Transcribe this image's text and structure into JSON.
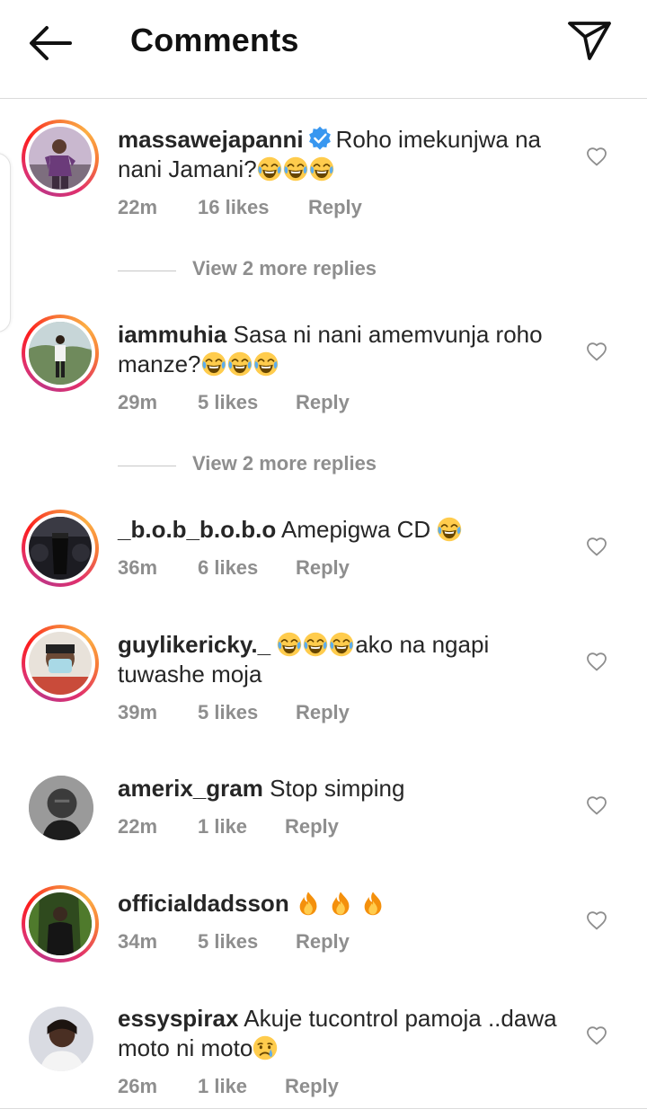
{
  "header": {
    "title": "Comments",
    "back_icon": "arrow-left-icon",
    "send_icon": "paper-plane-icon"
  },
  "view_replies_label": "View 2 more replies",
  "reply_label": "Reply",
  "comments": [
    {
      "username": "massawejapanni",
      "verified": true,
      "text": "Roho imekunjwa na nani Jamani?",
      "emojis": [
        "face-with-tears-of-joy",
        "face-with-tears-of-joy",
        "face-with-tears-of-joy"
      ],
      "time": "22m",
      "likes": "16 likes",
      "story_ring": true
    },
    {
      "username": "iammuhia",
      "text": "Sasa ni nani amemvunja roho manze?",
      "emojis": [
        "face-with-tears-of-joy",
        "face-with-tears-of-joy",
        "face-with-tears-of-joy"
      ],
      "time": "29m",
      "likes": "5 likes",
      "story_ring": true
    },
    {
      "username": "_b.o.b_b.o.b.o",
      "text": "Amepigwa CD",
      "emojis": [
        "face-with-tears-of-joy"
      ],
      "time": "36m",
      "likes": "6 likes",
      "story_ring": true
    },
    {
      "username": "guylikericky._",
      "text_after_emojis": "ako na ngapi tuwashe moja",
      "emojis": [
        "face-with-tears-of-joy",
        "face-with-tears-of-joy",
        "face-with-tears-of-joy"
      ],
      "time": "39m",
      "likes": "5 likes",
      "story_ring": true
    },
    {
      "username": "amerix_gram",
      "text": "Stop simping",
      "time": "22m",
      "likes": "1 like",
      "story_ring": false
    },
    {
      "username": "officialdadsson",
      "emojis": [
        "fire",
        "fire",
        "fire"
      ],
      "time": "34m",
      "likes": "5 likes",
      "story_ring": true
    },
    {
      "username": "essyspirax",
      "text": "Akuje tucontrol pamoja ..dawa moto ni moto",
      "emojis": [
        "crying-face"
      ],
      "time": "26m",
      "likes": "1 like",
      "story_ring": false
    }
  ],
  "colors": {
    "accent_blue": "#3897f0",
    "meta_gray": "#8e8e8e",
    "text": "#262626"
  }
}
